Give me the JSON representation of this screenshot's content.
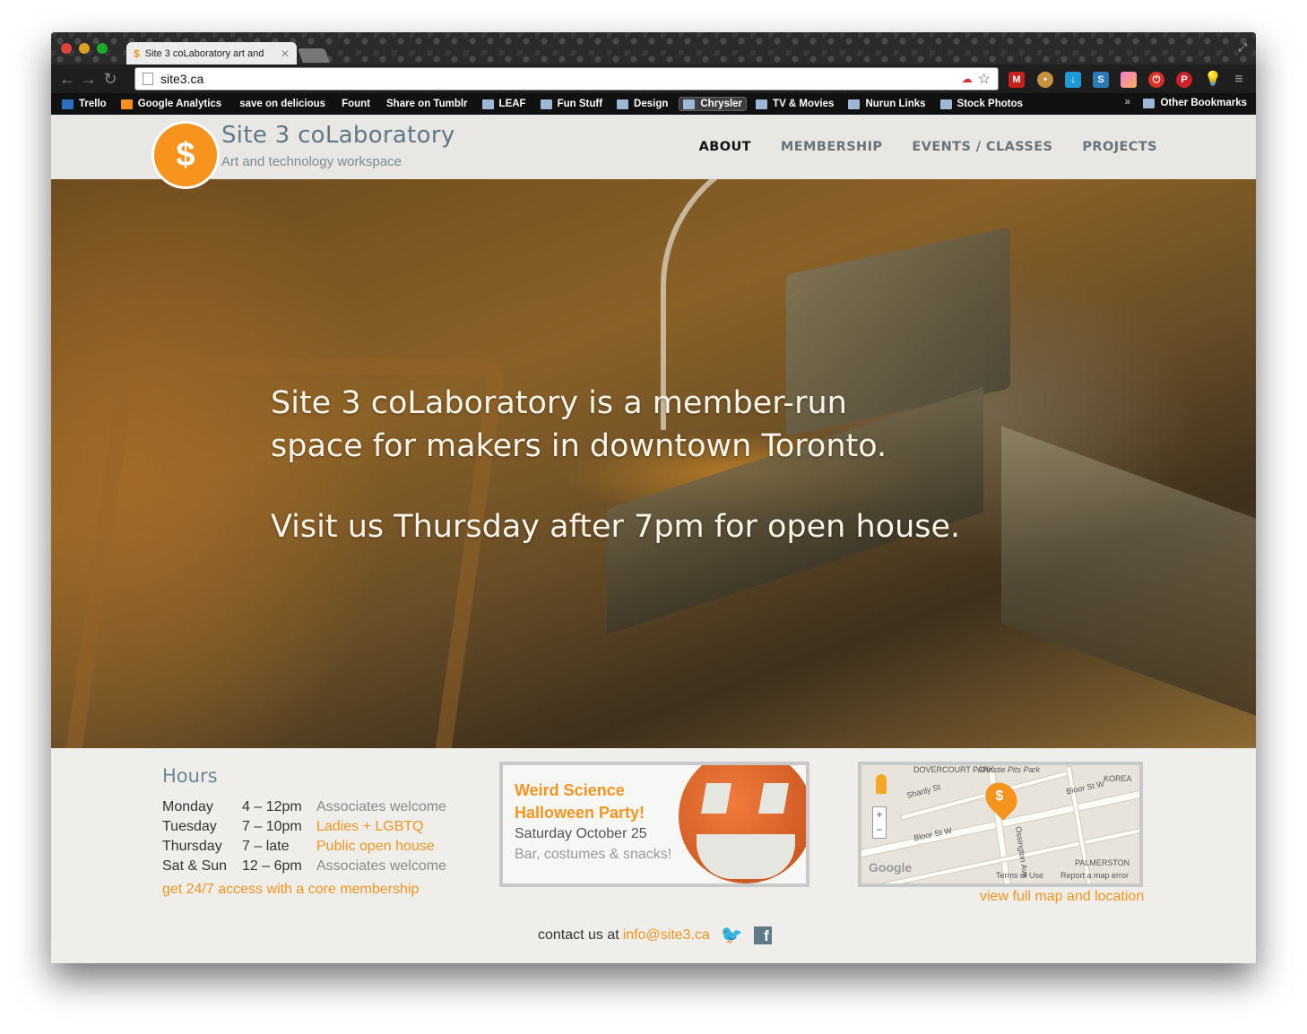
{
  "browser": {
    "tab_title": "Site 3 coLaboratory art and",
    "url": "site3.ca",
    "bookmarks": [
      "Trello",
      "Google Analytics",
      "save on delicious",
      "Fount",
      "Share on Tumblr",
      "LEAF",
      "Fun Stuff",
      "Design",
      "Chrysler",
      "TV & Movies",
      "Nurun Links",
      "Stock Photos"
    ],
    "other_bookmarks": "Other Bookmarks",
    "overflow": "»"
  },
  "site": {
    "logo_title": "Site 3 coLaboratory",
    "logo_subtitle": "Art and technology workspace",
    "nav": [
      "ABOUT",
      "MEMBERSHIP",
      "EVENTS / CLASSES",
      "PROJECTS"
    ],
    "hero": {
      "line1": "Site 3 coLaboratory is a member-run",
      "line2": "space for makers in downtown Toronto.",
      "line3": "Visit us Thursday after 7pm for open house."
    },
    "hours": {
      "title": "Hours",
      "rows": [
        {
          "day": "Monday",
          "time": "4 – 12pm",
          "note": "Associates welcome"
        },
        {
          "day": "Tuesday",
          "time": "7 – 10pm",
          "note": "Ladies + LGBTQ"
        },
        {
          "day": "Thursday",
          "time": "7 – late",
          "note": "Public open house"
        },
        {
          "day": "Sat & Sun",
          "time": "12 – 6pm",
          "note": "Associates welcome"
        }
      ],
      "cta": "get 24/7 access with a core membership"
    },
    "event": {
      "title1": "Weird Science",
      "title2": "Halloween Party!",
      "date": "Saturday October 25",
      "desc": "Bar, costumes & snacks!"
    },
    "map": {
      "labels": {
        "dovercourt": "DOVERCOURT PARK",
        "christie": "Christie Pits Park",
        "shanly": "Shanly St",
        "bloor_w": "Bloor St W",
        "bloor_e": "Bloor St W",
        "ossington": "Ossington Ave",
        "korea": "KOREA",
        "palmerston": "PALMERSTON",
        "terms": "Terms of Use",
        "report": "Report a map error",
        "google": "Google"
      },
      "link": "view full map and location"
    },
    "contact": {
      "prefix": "contact us at",
      "email": "info@site3.ca"
    }
  }
}
